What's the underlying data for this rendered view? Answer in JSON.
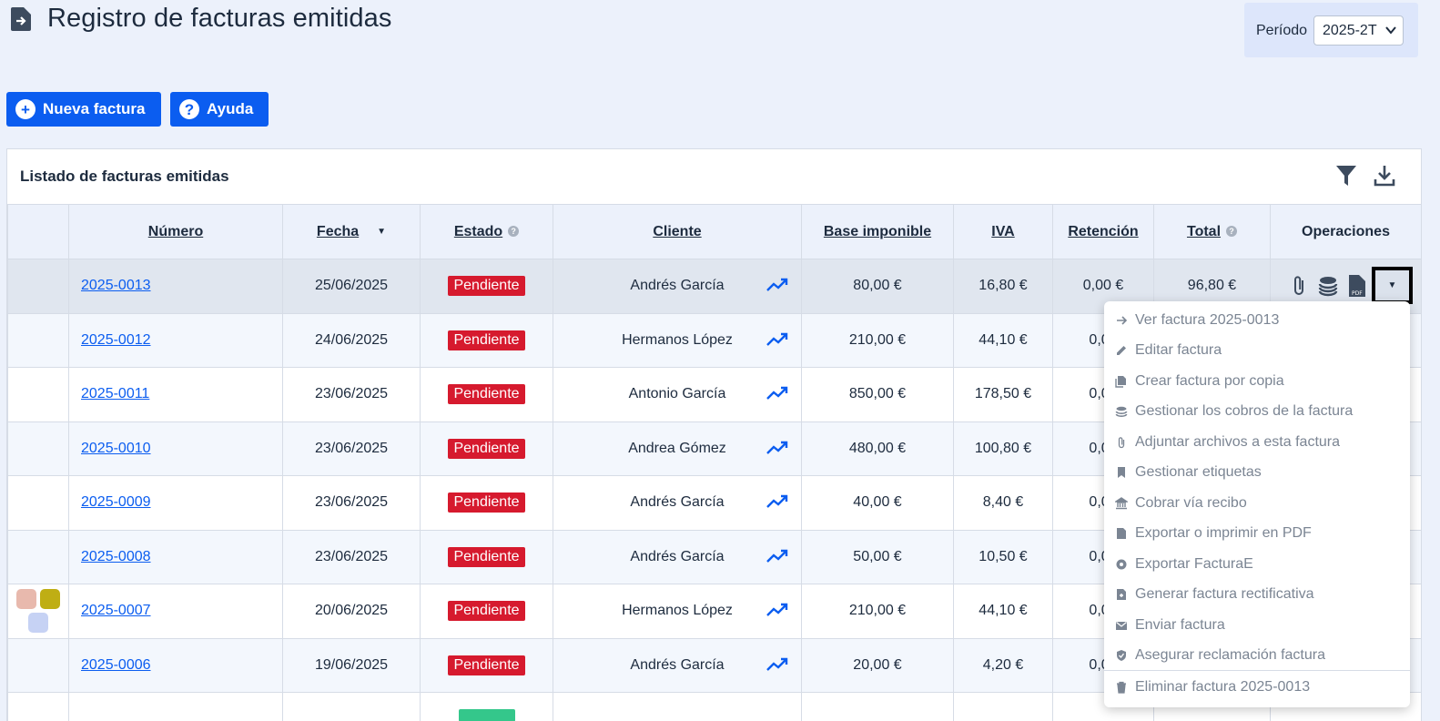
{
  "header": {
    "title": "Registro de facturas emitidas",
    "period_label": "Período",
    "period_value": "2025-2T"
  },
  "buttons": {
    "new": "Nueva factura",
    "help": "Ayuda",
    "new_icon": "+",
    "help_icon": "?"
  },
  "card": {
    "title": "Listado de facturas emitidas"
  },
  "table": {
    "headers": {
      "numero": "Número",
      "fecha": "Fecha",
      "estado": "Estado",
      "cliente": "Cliente",
      "base": "Base imponible",
      "iva": "IVA",
      "retencion": "Retención",
      "total": "Total",
      "operaciones": "Operaciones"
    },
    "rows": [
      {
        "numero": "2025-0013",
        "fecha": "25/06/2025",
        "estado": "Pendiente",
        "cliente": "Andrés García",
        "base": "80,00 €",
        "iva": "16,80 €",
        "retencion": "0,00 €",
        "total": "96,80 €"
      },
      {
        "numero": "2025-0012",
        "fecha": "24/06/2025",
        "estado": "Pendiente",
        "cliente": "Hermanos López",
        "base": "210,00 €",
        "iva": "44,10 €",
        "retencion": "0,00",
        "total": ""
      },
      {
        "numero": "2025-0011",
        "fecha": "23/06/2025",
        "estado": "Pendiente",
        "cliente": "Antonio García",
        "base": "850,00 €",
        "iva": "178,50 €",
        "retencion": "0,00",
        "total": ""
      },
      {
        "numero": "2025-0010",
        "fecha": "23/06/2025",
        "estado": "Pendiente",
        "cliente": "Andrea Gómez",
        "base": "480,00 €",
        "iva": "100,80 €",
        "retencion": "0,00",
        "total": ""
      },
      {
        "numero": "2025-0009",
        "fecha": "23/06/2025",
        "estado": "Pendiente",
        "cliente": "Andrés García",
        "base": "40,00 €",
        "iva": "8,40 €",
        "retencion": "0,00",
        "total": ""
      },
      {
        "numero": "2025-0008",
        "fecha": "23/06/2025",
        "estado": "Pendiente",
        "cliente": "Andrés García",
        "base": "50,00 €",
        "iva": "10,50 €",
        "retencion": "0,00",
        "total": ""
      },
      {
        "numero": "2025-0007",
        "fecha": "20/06/2025",
        "estado": "Pendiente",
        "cliente": "Hermanos López",
        "base": "210,00 €",
        "iva": "44,10 €",
        "retencion": "0,00",
        "total": ""
      },
      {
        "numero": "2025-0006",
        "fecha": "19/06/2025",
        "estado": "Pendiente",
        "cliente": "Andrés García",
        "base": "20,00 €",
        "iva": "4,20 €",
        "retencion": "0,00",
        "total": ""
      }
    ],
    "tag_colors": [
      "#e8b9ad",
      "#bfae14",
      "#c6d2f4"
    ]
  },
  "menu": {
    "items": [
      {
        "label": "Ver factura 2025-0013",
        "icon": "arrow-right-icon"
      },
      {
        "label": "Editar factura",
        "icon": "pencil-icon"
      },
      {
        "label": "Crear factura por copia",
        "icon": "copy-icon"
      },
      {
        "label": "Gestionar los cobros de la factura",
        "icon": "coins-icon"
      },
      {
        "label": "Adjuntar archivos a esta factura",
        "icon": "paperclip-icon"
      },
      {
        "label": "Gestionar etiquetas",
        "icon": "bookmark-icon"
      },
      {
        "label": "Cobrar vía recibo",
        "icon": "bank-icon"
      },
      {
        "label": "Exportar o imprimir en PDF",
        "icon": "pdf-icon"
      },
      {
        "label": "Exportar FacturaE",
        "icon": "facturae-icon"
      },
      {
        "label": "Generar factura rectificativa",
        "icon": "rectify-icon"
      },
      {
        "label": "Enviar factura",
        "icon": "mail-icon"
      },
      {
        "label": "Asegurar reclamación factura",
        "icon": "shield-icon"
      },
      {
        "label": "Eliminar factura 2025-0013",
        "icon": "trash-icon"
      }
    ]
  },
  "colors": {
    "primary": "#0b5df0",
    "danger": "#d61a2e",
    "background": "#ecf1fb"
  }
}
